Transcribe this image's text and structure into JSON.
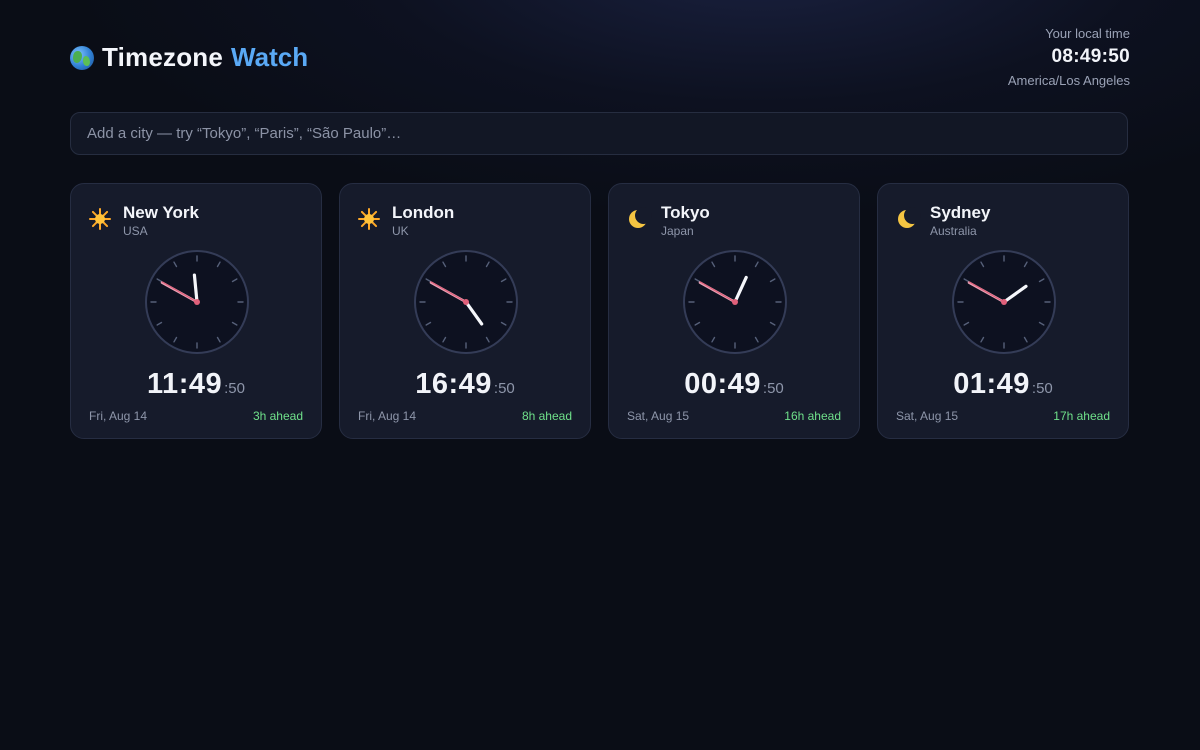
{
  "app": {
    "title_main": "Timezone",
    "title_accent": "Watch",
    "logo_icon": "globe-icon"
  },
  "local": {
    "label": "Your local time",
    "time": "08:49:50",
    "zone": "America/Los Angeles"
  },
  "search": {
    "placeholder": "Add a city — try “Tokyo”, “Paris”, “São Paulo”…",
    "value": ""
  },
  "colors": {
    "accent": "#5aa9f5",
    "ahead": "#6fe08a",
    "second_hand": "#e0607a",
    "minute_hand": "#e8a0b4"
  },
  "cities": [
    {
      "name": "New York",
      "country": "USA",
      "icon": "sun-icon",
      "hours": 11,
      "minutes": 49,
      "seconds": 50,
      "hm": "11:49",
      "sec": ":50",
      "date": "Fri, Aug 14",
      "offset": "3h ahead"
    },
    {
      "name": "London",
      "country": "UK",
      "icon": "sun-icon",
      "hours": 16,
      "minutes": 49,
      "seconds": 50,
      "hm": "16:49",
      "sec": ":50",
      "date": "Fri, Aug 14",
      "offset": "8h ahead"
    },
    {
      "name": "Tokyo",
      "country": "Japan",
      "icon": "moon-icon",
      "hours": 0,
      "minutes": 49,
      "seconds": 50,
      "hm": "00:49",
      "sec": ":50",
      "date": "Sat, Aug 15",
      "offset": "16h ahead"
    },
    {
      "name": "Sydney",
      "country": "Australia",
      "icon": "moon-icon",
      "hours": 1,
      "minutes": 49,
      "seconds": 50,
      "hm": "01:49",
      "sec": ":50",
      "date": "Sat, Aug 15",
      "offset": "17h ahead"
    }
  ]
}
